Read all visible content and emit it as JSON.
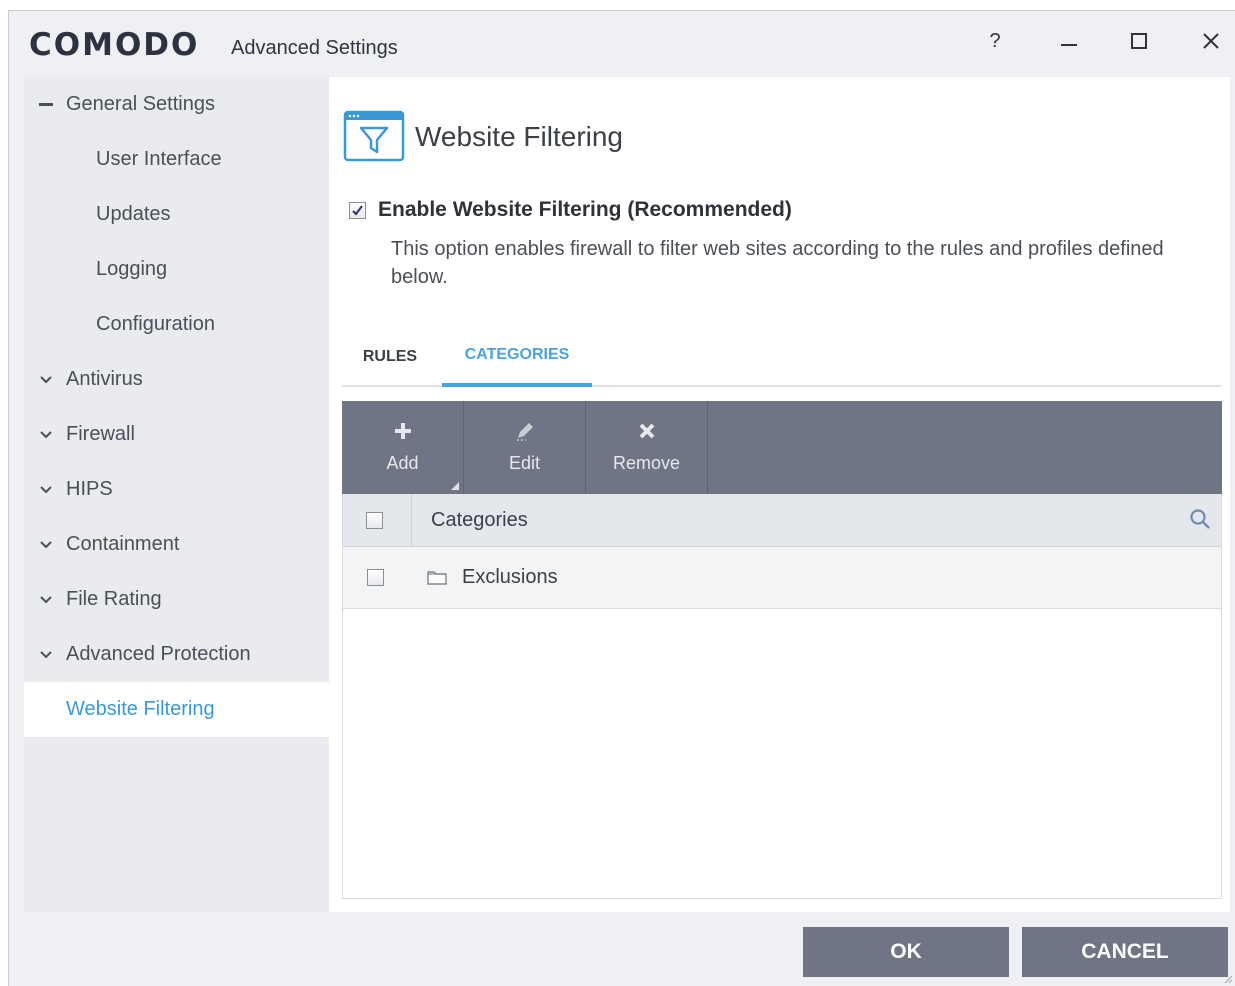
{
  "window": {
    "brand": "COMODO",
    "title": "Advanced Settings",
    "help_label": "?"
  },
  "sidebar": {
    "items": [
      {
        "label": "General Settings",
        "kind": "expanded"
      },
      {
        "label": "User Interface",
        "kind": "sub"
      },
      {
        "label": "Updates",
        "kind": "sub"
      },
      {
        "label": "Logging",
        "kind": "sub"
      },
      {
        "label": "Configuration",
        "kind": "sub"
      },
      {
        "label": "Antivirus",
        "kind": "collapsed"
      },
      {
        "label": "Firewall",
        "kind": "collapsed"
      },
      {
        "label": "HIPS",
        "kind": "collapsed"
      },
      {
        "label": "Containment",
        "kind": "collapsed"
      },
      {
        "label": "File Rating",
        "kind": "collapsed"
      },
      {
        "label": "Advanced Protection",
        "kind": "collapsed"
      },
      {
        "label": "Website Filtering",
        "kind": "active"
      }
    ]
  },
  "main": {
    "title": "Website Filtering",
    "icon": "filter-window-icon",
    "enable": {
      "label": "Enable Website Filtering (Recommended)",
      "checked": true
    },
    "description": "This option enables firewall to filter web sites according to the rules and profiles defined below.",
    "tabs": [
      {
        "label": "RULES",
        "active": false
      },
      {
        "label": "CATEGORIES",
        "active": true
      }
    ],
    "toolbar": {
      "add": "Add",
      "edit": "Edit",
      "remove": "Remove"
    },
    "grid": {
      "column": "Categories",
      "rows": [
        {
          "label": "Exclusions",
          "checked": false
        }
      ]
    }
  },
  "footer": {
    "ok": "OK",
    "cancel": "CANCEL"
  },
  "colors": {
    "accent": "#4aa3df",
    "toolbar": "#6f7585",
    "sidebar_bg": "#e9ebef"
  }
}
